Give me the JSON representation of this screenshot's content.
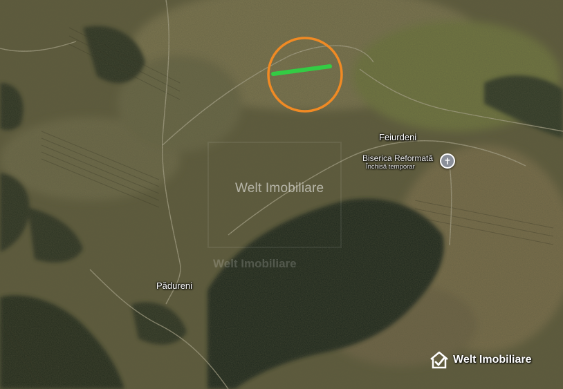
{
  "map": {
    "type": "satellite",
    "places": [
      {
        "name": "Feiurdeni"
      },
      {
        "name": "Pădureni"
      }
    ],
    "poi": {
      "name": "Biserica Reformată",
      "status": "Închisă temporar",
      "icon": "cross-icon"
    },
    "highlight": {
      "circle_color": "#f08a24",
      "line_color": "#33cc44"
    }
  },
  "watermarks": {
    "center": "Welt Imobiliare",
    "lower": "Welt Imobiliare",
    "corner": "Welt Imobiliare"
  },
  "colors": {
    "terrain_base": "#5a5a3a",
    "forest_dark": "#1e2418",
    "field_light": "#8a8258"
  }
}
